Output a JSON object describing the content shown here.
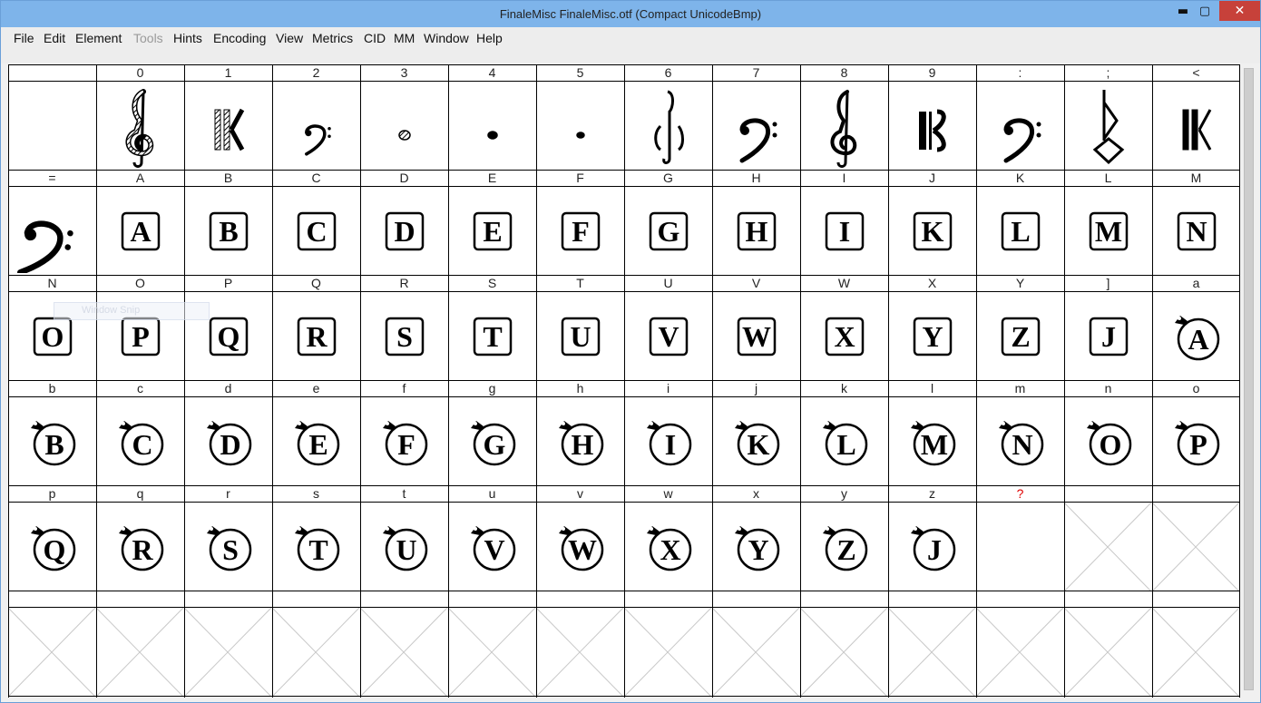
{
  "window": {
    "title": "FinaleMisc  FinaleMisc.otf (Compact UnicodeBmp)",
    "minimize_glyph": "▬",
    "maximize_glyph": "▢",
    "close_glyph": "✕"
  },
  "menu": [
    "File",
    "Edit",
    "Element",
    "Tools",
    "Hints",
    "Encoding",
    "View",
    "Metrics",
    "CID",
    "MM",
    "Window",
    "Help"
  ],
  "menu_disabled": [
    "Tools"
  ],
  "ghost_tooltip": "Window Snip",
  "rows": [
    {
      "labels": [
        "",
        "0",
        "1",
        "2",
        "3",
        "4",
        "5",
        "6",
        "7",
        "8",
        "9",
        ":",
        ";",
        "<"
      ],
      "glyphs": [
        {
          "kind": "empty"
        },
        {
          "kind": "music",
          "icon": "treble-clef-hatched-icon"
        },
        {
          "kind": "music",
          "icon": "percussion-clef-hatched-icon"
        },
        {
          "kind": "music",
          "icon": "bass-clef-small-icon"
        },
        {
          "kind": "music",
          "icon": "dot-hatched-icon"
        },
        {
          "kind": "music",
          "icon": "dot-small-icon"
        },
        {
          "kind": "music",
          "icon": "dot-tiny-icon"
        },
        {
          "kind": "music",
          "icon": "script-clef-icon"
        },
        {
          "kind": "music",
          "icon": "bass-clef-icon"
        },
        {
          "kind": "music",
          "icon": "treble-clef-icon"
        },
        {
          "kind": "music",
          "icon": "alto-clef-icon"
        },
        {
          "kind": "music",
          "icon": "bass-clef-icon"
        },
        {
          "kind": "music",
          "icon": "diamond-clef-icon"
        },
        {
          "kind": "music",
          "icon": "percussion-clef-icon"
        }
      ]
    },
    {
      "labels": [
        "=",
        "A",
        "B",
        "C",
        "D",
        "E",
        "F",
        "G",
        "H",
        "I",
        "J",
        "K",
        "L",
        "M"
      ],
      "glyphs": [
        {
          "kind": "music",
          "icon": "bass-clef-bold-icon"
        },
        {
          "kind": "box",
          "char": "A"
        },
        {
          "kind": "box",
          "char": "B"
        },
        {
          "kind": "box",
          "char": "C"
        },
        {
          "kind": "box",
          "char": "D"
        },
        {
          "kind": "box",
          "char": "E"
        },
        {
          "kind": "box",
          "char": "F"
        },
        {
          "kind": "box",
          "char": "G"
        },
        {
          "kind": "box",
          "char": "H"
        },
        {
          "kind": "box",
          "char": "I"
        },
        {
          "kind": "box",
          "char": "K"
        },
        {
          "kind": "box",
          "char": "L"
        },
        {
          "kind": "box",
          "char": "M"
        },
        {
          "kind": "box",
          "char": "N"
        }
      ]
    },
    {
      "labels": [
        "N",
        "O",
        "P",
        "Q",
        "R",
        "S",
        "T",
        "U",
        "V",
        "W",
        "X",
        "Y",
        "]",
        "a"
      ],
      "glyphs": [
        {
          "kind": "box",
          "char": "O"
        },
        {
          "kind": "box",
          "char": "P"
        },
        {
          "kind": "box",
          "char": "Q"
        },
        {
          "kind": "box",
          "char": "R"
        },
        {
          "kind": "box",
          "char": "S"
        },
        {
          "kind": "box",
          "char": "T"
        },
        {
          "kind": "box",
          "char": "U"
        },
        {
          "kind": "box",
          "char": "V"
        },
        {
          "kind": "box",
          "char": "W"
        },
        {
          "kind": "box",
          "char": "X"
        },
        {
          "kind": "box",
          "char": "Y"
        },
        {
          "kind": "box",
          "char": "Z"
        },
        {
          "kind": "box",
          "char": "J"
        },
        {
          "kind": "circle",
          "char": "A"
        }
      ]
    },
    {
      "labels": [
        "b",
        "c",
        "d",
        "e",
        "f",
        "g",
        "h",
        "i",
        "j",
        "k",
        "l",
        "m",
        "n",
        "o"
      ],
      "glyphs": [
        {
          "kind": "circle",
          "char": "B"
        },
        {
          "kind": "circle",
          "char": "C"
        },
        {
          "kind": "circle",
          "char": "D"
        },
        {
          "kind": "circle",
          "char": "E"
        },
        {
          "kind": "circle",
          "char": "F"
        },
        {
          "kind": "circle",
          "char": "G"
        },
        {
          "kind": "circle",
          "char": "H"
        },
        {
          "kind": "circle",
          "char": "I"
        },
        {
          "kind": "circle",
          "char": "K"
        },
        {
          "kind": "circle",
          "char": "L"
        },
        {
          "kind": "circle",
          "char": "M"
        },
        {
          "kind": "circle",
          "char": "N"
        },
        {
          "kind": "circle",
          "char": "O"
        },
        {
          "kind": "circle",
          "char": "P"
        }
      ]
    },
    {
      "labels": [
        "p",
        "q",
        "r",
        "s",
        "t",
        "u",
        "v",
        "w",
        "x",
        "y",
        "z",
        "?",
        "",
        ""
      ],
      "missing_label_index": 11,
      "glyphs": [
        {
          "kind": "circle",
          "char": "Q"
        },
        {
          "kind": "circle",
          "char": "R"
        },
        {
          "kind": "circle",
          "char": "S"
        },
        {
          "kind": "circle",
          "char": "T"
        },
        {
          "kind": "circle",
          "char": "U"
        },
        {
          "kind": "circle",
          "char": "V"
        },
        {
          "kind": "circle",
          "char": "W"
        },
        {
          "kind": "circle",
          "char": "X"
        },
        {
          "kind": "circle",
          "char": "Y"
        },
        {
          "kind": "circle",
          "char": "Z"
        },
        {
          "kind": "circle",
          "char": "J"
        },
        {
          "kind": "empty"
        },
        {
          "kind": "unencoded"
        },
        {
          "kind": "unencoded"
        }
      ]
    },
    {
      "labels": [
        "",
        "",
        "",
        "",
        "",
        "",
        "",
        "",
        "",
        "",
        "",
        "",
        "",
        ""
      ],
      "glyphs": [
        {
          "kind": "unencoded"
        },
        {
          "kind": "unencoded"
        },
        {
          "kind": "unencoded"
        },
        {
          "kind": "unencoded"
        },
        {
          "kind": "unencoded"
        },
        {
          "kind": "unencoded"
        },
        {
          "kind": "unencoded"
        },
        {
          "kind": "unencoded"
        },
        {
          "kind": "unencoded"
        },
        {
          "kind": "unencoded"
        },
        {
          "kind": "unencoded"
        },
        {
          "kind": "unencoded"
        },
        {
          "kind": "unencoded"
        },
        {
          "kind": "unencoded"
        }
      ]
    }
  ],
  "colors": {
    "titlebar": "#7eb4ea",
    "close_button": "#c7413a",
    "missing_label": "#e00000",
    "unencoded_cross": "#c8c8c8"
  }
}
